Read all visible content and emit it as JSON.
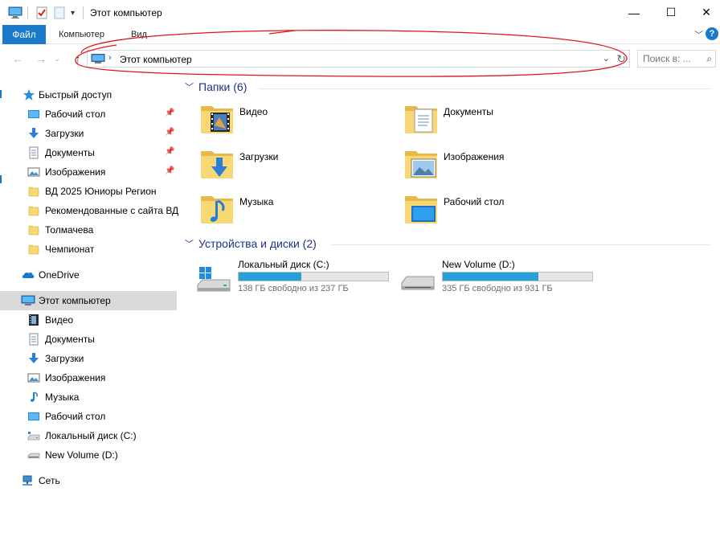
{
  "window": {
    "title": "Этот компьютер",
    "controls": {
      "minimize": "—",
      "maximize": "☐",
      "close": "✕"
    }
  },
  "ribbon": {
    "tabs": [
      {
        "label": "Файл",
        "active": true
      },
      {
        "label": "Компьютер"
      },
      {
        "label": "Вид"
      }
    ],
    "help": "?"
  },
  "address": {
    "path": "Этот компьютер",
    "search_placeholder": "Поиск в: ..."
  },
  "nav": {
    "quick_access": "Быстрый доступ",
    "quick_items": [
      {
        "label": "Рабочий стол",
        "icon": "desktop-icon",
        "pinned": true
      },
      {
        "label": "Загрузки",
        "icon": "downloads-icon",
        "pinned": true
      },
      {
        "label": "Документы",
        "icon": "documents-icon",
        "pinned": true
      },
      {
        "label": "Изображения",
        "icon": "pictures-icon",
        "pinned": true
      },
      {
        "label": "ВД 2025 Юниоры Регион",
        "icon": "folder-icon"
      },
      {
        "label": "Рекомендованные с сайта ВД",
        "icon": "folder-icon"
      },
      {
        "label": "Толмачева",
        "icon": "folder-icon"
      },
      {
        "label": "Чемпионат",
        "icon": "folder-icon"
      }
    ],
    "onedrive": "OneDrive",
    "this_pc": "Этот компьютер",
    "pc_items": [
      {
        "label": "Видео",
        "icon": "video-icon"
      },
      {
        "label": "Документы",
        "icon": "documents-icon"
      },
      {
        "label": "Загрузки",
        "icon": "downloads-icon"
      },
      {
        "label": "Изображения",
        "icon": "pictures-icon"
      },
      {
        "label": "Музыка",
        "icon": "music-icon"
      },
      {
        "label": "Рабочий стол",
        "icon": "desktop-icon"
      },
      {
        "label": "Локальный диск (C:)",
        "icon": "drive-c-icon"
      },
      {
        "label": "New Volume (D:)",
        "icon": "drive-d-icon"
      }
    ],
    "network": "Сеть"
  },
  "content": {
    "folders_header": "Папки (6)",
    "folders": [
      {
        "name": "Видео",
        "icon": "video-folder-icon"
      },
      {
        "name": "Документы",
        "icon": "documents-folder-icon"
      },
      {
        "name": "Загрузки",
        "icon": "downloads-folder-icon"
      },
      {
        "name": "Изображения",
        "icon": "pictures-folder-icon"
      },
      {
        "name": "Музыка",
        "icon": "music-folder-icon"
      },
      {
        "name": "Рабочий стол",
        "icon": "desktop-folder-icon"
      }
    ],
    "drives_header": "Устройства и диски (2)",
    "drives": [
      {
        "name": "Локальный диск (C:)",
        "free_text": "138 ГБ свободно из 237 ГБ",
        "used_fraction": 0.418
      },
      {
        "name": "New Volume (D:)",
        "free_text": "335 ГБ свободно из 931 ГБ",
        "used_fraction": 0.64
      }
    ]
  },
  "colors": {
    "accent": "#1979ca",
    "folder": "#f8d775",
    "folder_dark": "#e8b84a",
    "drive_bar": "#26a0da",
    "annotation": "#e0141e",
    "selected": "#d9d9d9"
  }
}
